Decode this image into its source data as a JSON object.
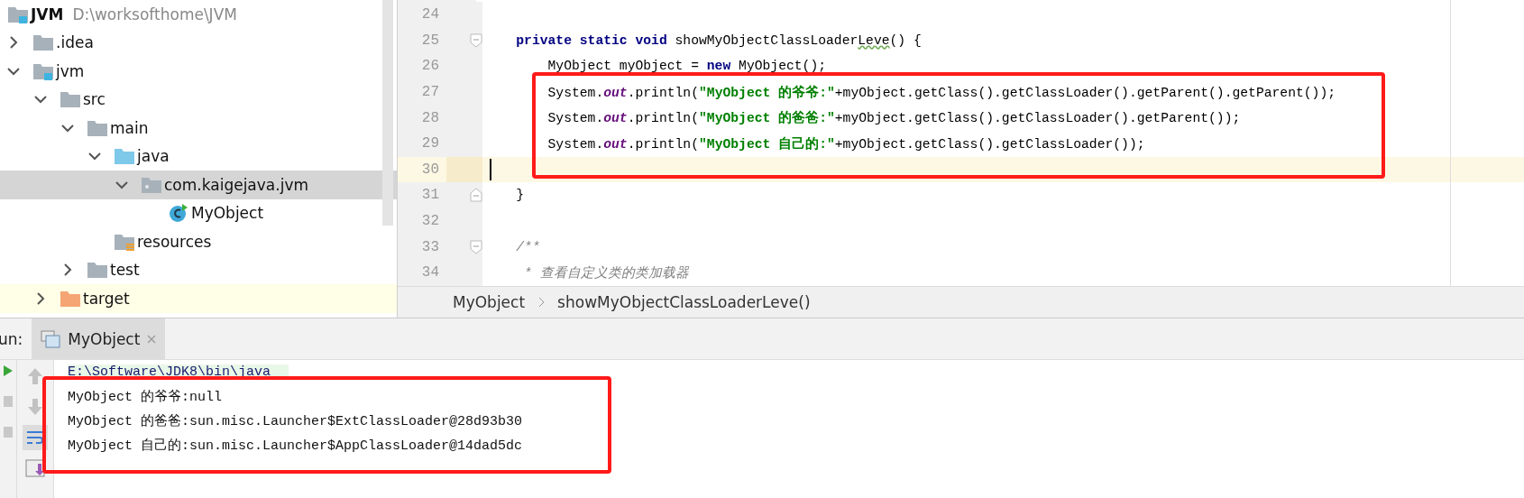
{
  "project_tree": {
    "root": {
      "label": "JVM",
      "path": "D:\\worksofthome\\JVM",
      "kind": "module",
      "selected": false
    },
    "items": [
      {
        "label": ".idea",
        "kind": "folder",
        "expanded": false,
        "selected": false
      },
      {
        "label": "jvm",
        "kind": "module",
        "expanded": true,
        "selected": false,
        "children": [
          {
            "label": "src",
            "kind": "folder",
            "expanded": true,
            "selected": false,
            "children": [
              {
                "label": "main",
                "kind": "folder",
                "expanded": true,
                "selected": false,
                "children": [
                  {
                    "label": "java",
                    "kind": "source",
                    "expanded": true,
                    "selected": false,
                    "children": [
                      {
                        "label": "com.kaigejava.jvm",
                        "kind": "package",
                        "expanded": true,
                        "selected": true,
                        "children": [
                          {
                            "label": "MyObject",
                            "kind": "class",
                            "selected": false
                          }
                        ]
                      }
                    ]
                  },
                  {
                    "label": "resources",
                    "kind": "resources",
                    "selected": false
                  }
                ]
              },
              {
                "label": "test",
                "kind": "folder",
                "expanded": false,
                "selected": false
              }
            ]
          },
          {
            "label": "target",
            "kind": "excluded",
            "expanded": false,
            "selected": false
          }
        ]
      }
    ]
  },
  "editor": {
    "lines": [
      {
        "number": "24",
        "current": false,
        "fold_start": false,
        "fold_end": false
      },
      {
        "number": "25",
        "current": false,
        "fold_start": true,
        "fold_end": false,
        "tokens": [
          {
            "text": "    private static void ",
            "kind": "keyword"
          },
          {
            "text": "showMyObjectClassLoader",
            "kind": "plain"
          },
          {
            "text": "Leve",
            "kind": "typo"
          },
          {
            "text": "() {",
            "kind": "plain"
          }
        ]
      },
      {
        "number": "26",
        "current": false,
        "fold_start": false,
        "fold_end": false,
        "tokens": [
          {
            "text": "        MyObject myObject = ",
            "kind": "plain"
          },
          {
            "text": "new ",
            "kind": "keyword"
          },
          {
            "text": "MyObject();",
            "kind": "plain"
          }
        ]
      },
      {
        "number": "27",
        "current": false,
        "fold_start": false,
        "fold_end": false,
        "tokens": [
          {
            "text": "        System.",
            "kind": "plain"
          },
          {
            "text": "out",
            "kind": "field"
          },
          {
            "text": ".println(",
            "kind": "plain"
          },
          {
            "text": "\"MyObject 的爷爷:\"",
            "kind": "string"
          },
          {
            "text": "+myObject.getClass().getClassLoader().getParent().getParent());",
            "kind": "plain"
          }
        ]
      },
      {
        "number": "28",
        "current": false,
        "fold_start": false,
        "fold_end": false,
        "tokens": [
          {
            "text": "        System.",
            "kind": "plain"
          },
          {
            "text": "out",
            "kind": "field"
          },
          {
            "text": ".println(",
            "kind": "plain"
          },
          {
            "text": "\"MyObject 的爸爸:\"",
            "kind": "string"
          },
          {
            "text": "+myObject.getClass().getClassLoader().getParent());",
            "kind": "plain"
          }
        ]
      },
      {
        "number": "29",
        "current": false,
        "fold_start": false,
        "fold_end": false,
        "tokens": [
          {
            "text": "        System.",
            "kind": "plain"
          },
          {
            "text": "out",
            "kind": "field"
          },
          {
            "text": ".println(",
            "kind": "plain"
          },
          {
            "text": "\"MyObject 自己的:\"",
            "kind": "string"
          },
          {
            "text": "+myObject.getClass().getClassLoader());",
            "kind": "plain"
          }
        ]
      },
      {
        "number": "30",
        "current": true,
        "fold_start": false,
        "fold_end": false
      },
      {
        "number": "31",
        "current": false,
        "fold_start": false,
        "fold_end": true,
        "tokens": [
          {
            "text": "    }",
            "kind": "plain"
          }
        ]
      },
      {
        "number": "32",
        "current": false,
        "fold_start": false,
        "fold_end": false
      },
      {
        "number": "33",
        "current": false,
        "fold_start": true,
        "fold_end": false,
        "tokens": [
          {
            "text": "    /**",
            "kind": "comment"
          }
        ]
      },
      {
        "number": "34",
        "current": false,
        "fold_start": false,
        "fold_end": false,
        "tokens": [
          {
            "text": "     * 查看自定义类的类加载器",
            "kind": "comment"
          }
        ]
      }
    ],
    "breadcrumb": [
      "MyObject",
      "showMyObjectClassLoaderLeve()"
    ]
  },
  "run_panel": {
    "label": "un:",
    "tabs": [
      {
        "label": "MyObject",
        "selected": true
      }
    ],
    "console": [
      {
        "text": "E:\\Software\\JDK8\\bin\\java",
        "kind": "command"
      },
      {
        "text": "MyObject 的爷爷:null",
        "kind": "output"
      },
      {
        "text": "MyObject 的爸爸:sun.misc.Launcher$ExtClassLoader@28d93b30",
        "kind": "output"
      },
      {
        "text": "MyObject 自己的:sun.misc.Launcher$AppClassLoader@14dad5dc",
        "kind": "output"
      }
    ]
  }
}
